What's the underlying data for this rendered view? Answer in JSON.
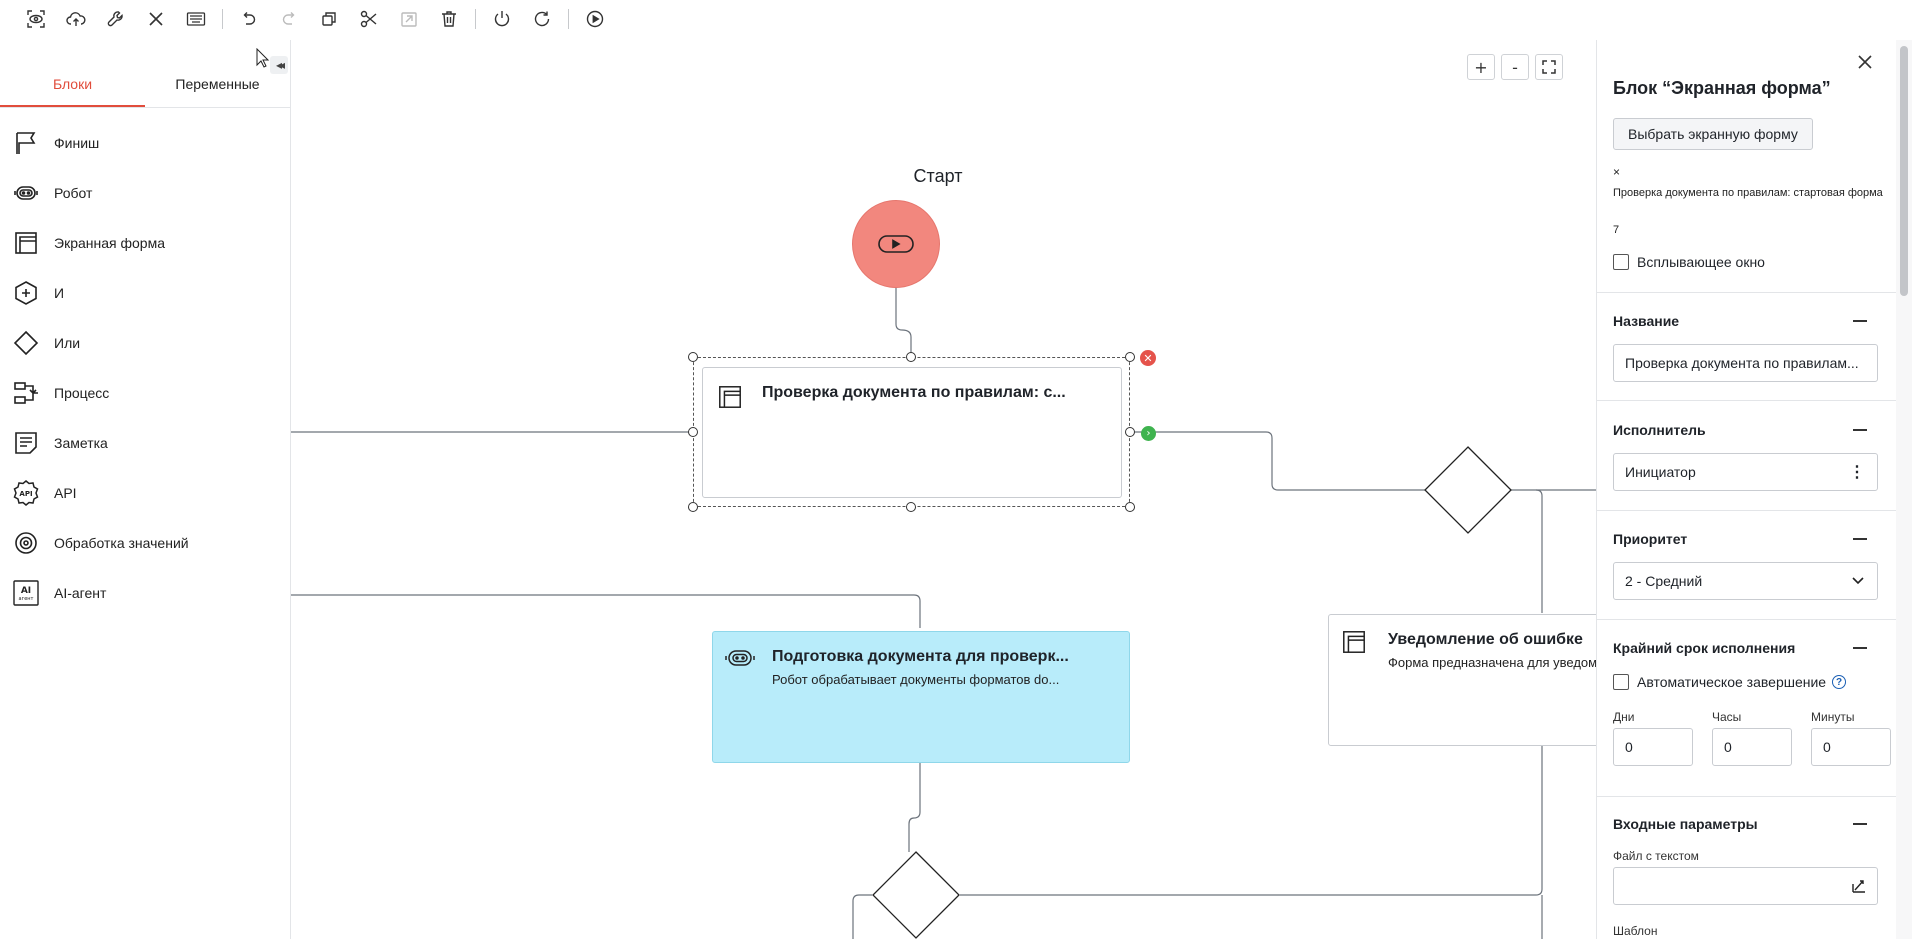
{
  "toolbar": {
    "icons": [
      "preview-icon",
      "cloud-upload-icon",
      "wrench-icon",
      "close-icon",
      "keyboard-icon",
      "undo-icon",
      "redo-icon",
      "copy-icon",
      "cut-icon",
      "paste-icon",
      "delete-icon",
      "power-icon",
      "refresh-icon",
      "play-icon"
    ]
  },
  "left_panel": {
    "tabs": [
      "Блоки",
      "Переменные"
    ],
    "active_tab": "Блоки",
    "blocks": [
      {
        "icon": "flag-icon",
        "label": "Финиш"
      },
      {
        "icon": "robot-icon",
        "label": "Робот"
      },
      {
        "icon": "screen-form-icon",
        "label": "Экранная форма"
      },
      {
        "icon": "and-icon",
        "label": "И"
      },
      {
        "icon": "or-diamond-icon",
        "label": "Или"
      },
      {
        "icon": "process-icon",
        "label": "Процесс"
      },
      {
        "icon": "note-icon",
        "label": "Заметка"
      },
      {
        "icon": "api-icon",
        "label": "API"
      },
      {
        "icon": "value-processing-icon",
        "label": "Обработка значений"
      },
      {
        "icon": "ai-agent-icon",
        "label": "AI-агент"
      }
    ],
    "ai_icon_text": [
      "AI",
      "агент"
    ]
  },
  "canvas": {
    "zoom": {
      "plus": "+",
      "minus": "-"
    },
    "start_label": "Старт",
    "nodes": {
      "check": {
        "title": "Проверка документа по правилам: с..."
      },
      "prepare": {
        "title": "Подготовка документа для проверк...",
        "desc": "Робот обрабатывает документы форматов do..."
      },
      "notify": {
        "title": "Уведомление об ошибке",
        "desc": "Форма предназначена для уведомления"
      }
    },
    "colors": {
      "start": "#f2877e",
      "robot_node": "#b8ecfa",
      "delete": "#e5534b",
      "connect": "#3fb34f",
      "accent": "#e14d3c"
    }
  },
  "right_panel": {
    "title": "Блок “Экранная форма”",
    "select_button": "Выбрать экранную форму",
    "remove_mark": "×",
    "form_name": "Проверка документа по правилам: стартовая форма",
    "form_id": "7",
    "popup_label": "Всплывающее окно",
    "sections": {
      "name": {
        "title": "Название",
        "value": "Проверка документа по правилам..."
      },
      "executor": {
        "title": "Исполнитель",
        "value": "Инициатор"
      },
      "priority": {
        "title": "Приоритет",
        "value": "2 - Средний"
      },
      "deadline": {
        "title": "Крайний срок исполнения",
        "auto_label": "Автоматическое завершение",
        "days_label": "Дни",
        "hours_label": "Часы",
        "minutes_label": "Минуты",
        "days": "0",
        "hours": "0",
        "minutes": "0"
      },
      "input": {
        "title": "Входные параметры",
        "file_label": "Файл с текстом",
        "next_label": "Шаблон"
      }
    }
  }
}
